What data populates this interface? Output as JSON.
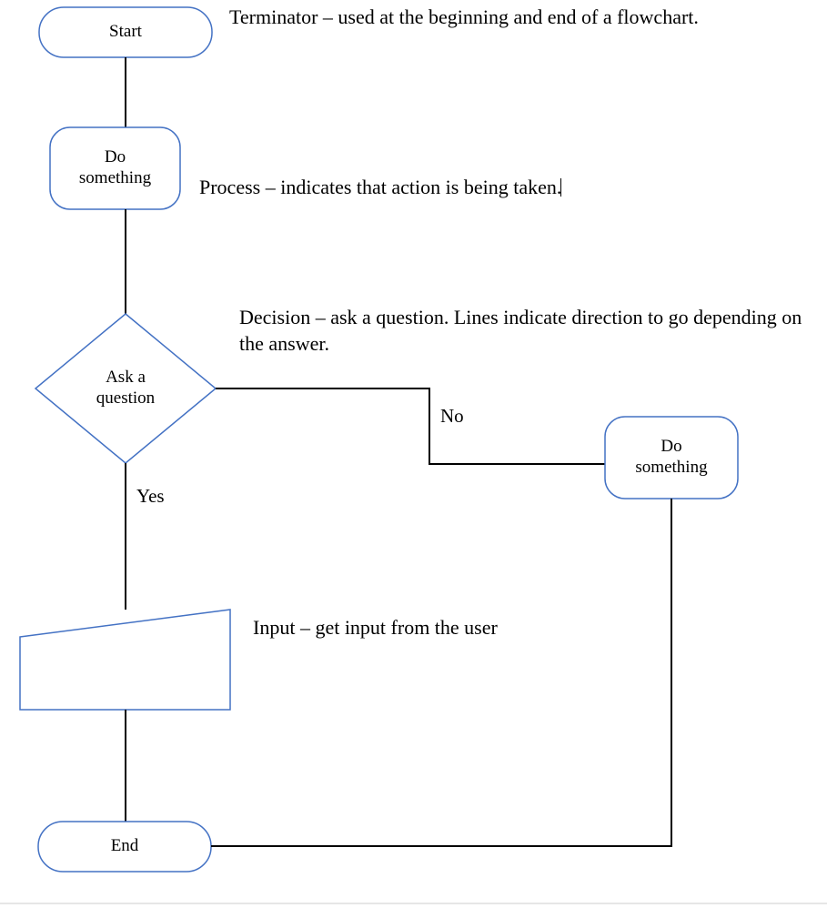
{
  "nodes": {
    "start": {
      "label": "Start"
    },
    "process1": {
      "label": "Do\nsomething"
    },
    "decision": {
      "label": "Ask a\nquestion"
    },
    "process2": {
      "label": "Do\nsomething"
    },
    "input": {
      "label": ""
    },
    "end": {
      "label": "End"
    }
  },
  "edges": {
    "yes": "Yes",
    "no": "No"
  },
  "descriptions": {
    "terminator": "Terminator – used at the beginning and end of a flowchart.",
    "process": "Process – indicates that action is being taken.",
    "decision": "Decision – ask a question. Lines indicate direction to go depending on the answer.",
    "input": "Input – get input from the user"
  },
  "colors": {
    "shape_stroke": "#4472C4",
    "line_stroke": "#000000"
  }
}
